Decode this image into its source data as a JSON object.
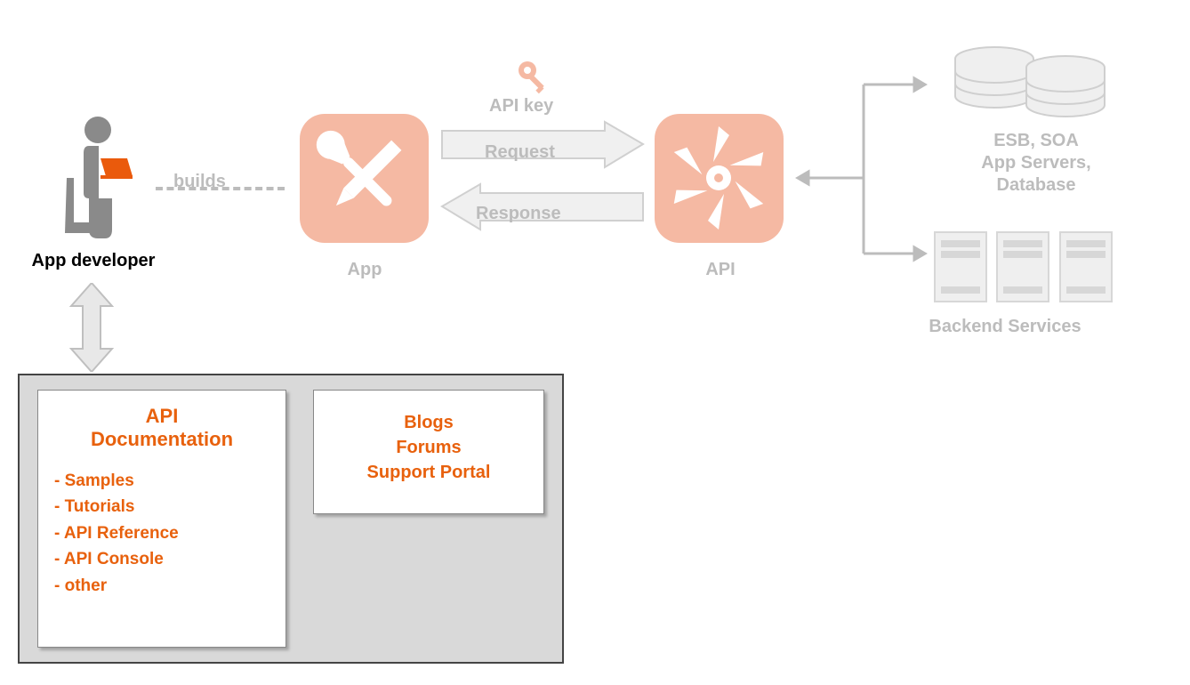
{
  "nodes": {
    "developer": "App developer",
    "app": "App",
    "api": "API",
    "backend": "Backend Services",
    "db_line1": "ESB, SOA",
    "db_line2": "App Servers,",
    "db_line3": "Database"
  },
  "edges": {
    "builds": "builds",
    "apikey": "API key",
    "request": "Request",
    "response": "Response"
  },
  "portal": {
    "doc_title_line1": "API",
    "doc_title_line2": "Documentation",
    "doc_items": {
      "i1": "- Samples",
      "i2": "- Tutorials",
      "i3": "- API Reference",
      "i4": "- API Console",
      "i5": "- other"
    },
    "community": {
      "c1": "Blogs",
      "c2": "Forums",
      "c3": "Support Portal"
    }
  }
}
